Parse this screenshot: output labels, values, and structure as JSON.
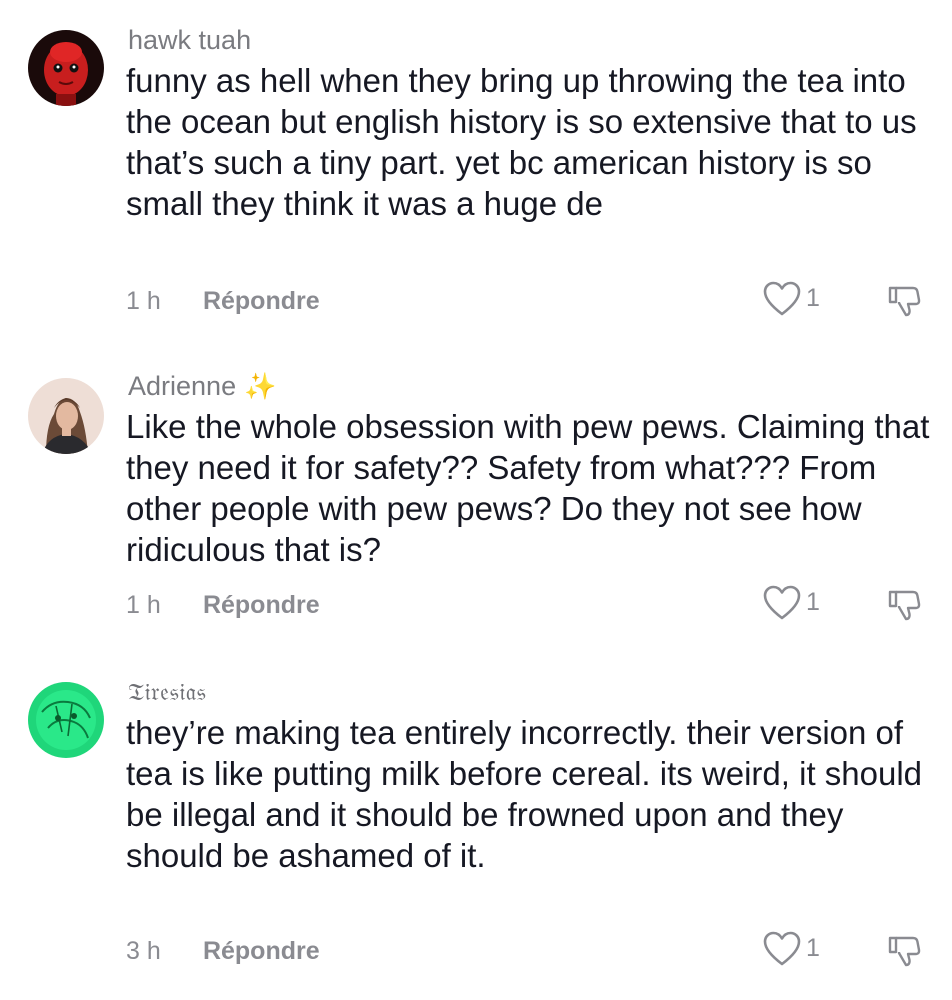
{
  "comments": [
    {
      "username": "hawk tuah",
      "text": "funny as hell when they bring up throwing the tea into the ocean but english history is so extensive that to us that’s such a tiny part. yet bc american history is so small they think it was a huge de",
      "time": "1 h",
      "reply_label": "Répondre",
      "likes": "1",
      "avatar_icon": "red-face-avatar"
    },
    {
      "username": "Adrienne",
      "username_emoji": "✨",
      "text": "Like the whole obsession with pew pews. Claiming that they need it for safety?? Safety from what??? From other people with pew pews? Do they not see how ridiculous that is?",
      "time": "1 h",
      "reply_label": "Répondre",
      "likes": "1",
      "avatar_icon": "woman-photo-avatar"
    },
    {
      "username": "𝔗𝔦𝔯𝔢𝔰𝔦𝔞𝔰",
      "text": "they’re making tea entirely incorrectly. their version of tea is like putting milk before cereal. its weird, it should be illegal and it should be frowned upon and they should be ashamed of it.",
      "time": "3 h",
      "reply_label": "Répondre",
      "likes": "1",
      "avatar_icon": "green-sketch-avatar"
    }
  ],
  "colors": {
    "text": "#161823",
    "secondary": "#8a8b91",
    "sparkle": "#f5c542"
  }
}
